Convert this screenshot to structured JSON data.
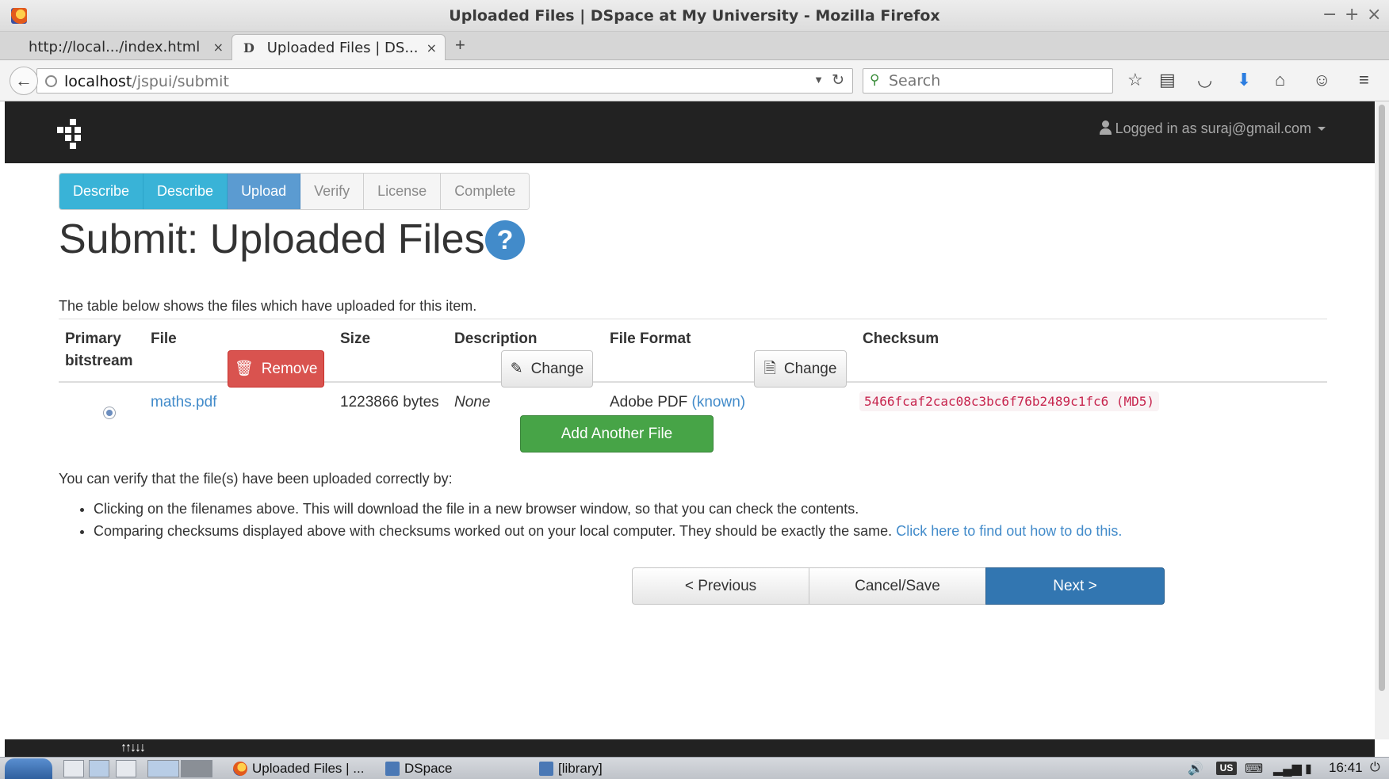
{
  "window": {
    "title": "Uploaded Files | DSpace at My University - Mozilla Firefox",
    "controls": [
      "−",
      "+",
      "×"
    ]
  },
  "tabs": [
    {
      "label": "http://local.../index.html",
      "active": false,
      "close": "×"
    },
    {
      "label": "Uploaded Files | DS...",
      "active": true,
      "close": "×"
    }
  ],
  "new_tab": "+",
  "navbar": {
    "url_host": "localhost",
    "url_path": "/jspui/submit",
    "search_placeholder": "Search"
  },
  "header": {
    "user_text": "Logged in as suraj@gmail.com"
  },
  "steps": [
    {
      "label": "Describe",
      "state": "done"
    },
    {
      "label": "Describe",
      "state": "done"
    },
    {
      "label": "Upload",
      "state": "current"
    },
    {
      "label": "Verify",
      "state": "pending"
    },
    {
      "label": "License",
      "state": "pending"
    },
    {
      "label": "Complete",
      "state": "pending"
    }
  ],
  "page": {
    "title": "Submit: Uploaded Files",
    "help": "?",
    "intro": "The table below shows the files which have uploaded for this item."
  },
  "table": {
    "headers": {
      "primary_line1": "Primary",
      "primary_line2": "bitstream",
      "file": "File",
      "size": "Size",
      "description": "Description",
      "format": "File Format",
      "checksum": "Checksum"
    },
    "row": {
      "file": "maths.pdf",
      "remove_label": "Remove",
      "size": "1223866 bytes",
      "description": "None",
      "change_desc_label": "Change",
      "format": "Adobe PDF",
      "format_status": "(known)",
      "change_format_label": "Change",
      "checksum": "5466fcaf2cac08c3bc6f76b2489c1fc6 (MD5)"
    }
  },
  "add_file_label": "Add Another File",
  "verify": {
    "lead": "You can verify that the file(s) have been uploaded correctly by:",
    "bullet1": "Clicking on the filenames above. This will download the file in a new browser window, so that you can check the contents.",
    "bullet2": "Comparing checksums displayed above with checksums worked out on your local computer. They should be exactly the same.",
    "bullet2_link": "Click here to find out how to do this."
  },
  "pager": {
    "previous": "< Previous",
    "cancel": "Cancel/Save",
    "next": "Next >"
  },
  "taskbar": {
    "items": [
      "Uploaded Files | ...",
      "DSpace",
      "[library]"
    ],
    "keyboard_layout": "US",
    "clock": "16:41"
  },
  "colors": {
    "step_done": "#39b3d7",
    "step_current": "#5b9bd1",
    "danger": "#d9534f",
    "success": "#47a447",
    "primary": "#3276b1",
    "checksum_text": "#c7254e"
  }
}
